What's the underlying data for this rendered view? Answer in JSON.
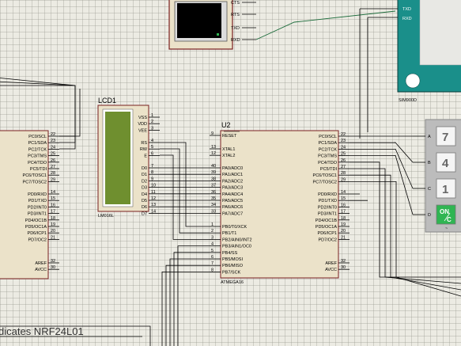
{
  "terminal": {
    "pins": [
      "CTS",
      "RTS",
      "TXD",
      "RXD"
    ]
  },
  "gsm": {
    "name": "SIM900D",
    "pins": [
      "TXD",
      "RXD"
    ]
  },
  "lcd": {
    "ref": "LCD1",
    "model": "LM016L",
    "pins_top": [
      {
        "label": "VSS",
        "num": "1"
      },
      {
        "label": "VDD",
        "num": "2"
      },
      {
        "label": "VEE",
        "num": "3"
      }
    ],
    "pins_ctrl": [
      {
        "label": "RS",
        "num": "4"
      },
      {
        "label": "RW",
        "num": "5"
      },
      {
        "label": "E",
        "num": "6"
      }
    ],
    "pins_data": [
      {
        "label": "D0",
        "num": "7"
      },
      {
        "label": "D1",
        "num": "8"
      },
      {
        "label": "D2",
        "num": "9"
      },
      {
        "label": "D3",
        "num": "10"
      },
      {
        "label": "D4",
        "num": "11"
      },
      {
        "label": "D5",
        "num": "12"
      },
      {
        "label": "D6",
        "num": "13"
      },
      {
        "label": "D7",
        "num": "14"
      }
    ]
  },
  "mcu_left": {
    "portc": [
      {
        "label": "PC0/SCL",
        "num": "22"
      },
      {
        "label": "PC1/SDA",
        "num": "23"
      },
      {
        "label": "PC2/TCK",
        "num": "24"
      },
      {
        "label": "PC3/TMS",
        "num": "25"
      },
      {
        "label": "PC4/TDO",
        "num": "26"
      },
      {
        "label": "PC5/TDI",
        "num": "27"
      },
      {
        "label": "PC6/TOSC1",
        "num": "28"
      },
      {
        "label": "PC7/TOSC2",
        "num": "29"
      }
    ],
    "portd": [
      {
        "label": "PD0/RXD",
        "num": "14"
      },
      {
        "label": "PD1/TXD",
        "num": "15"
      },
      {
        "label": "PD2/INT0",
        "num": "16"
      },
      {
        "label": "PD3/INT1",
        "num": "17"
      },
      {
        "label": "PD4/OC1B",
        "num": "18"
      },
      {
        "label": "PD5/OC1A",
        "num": "19"
      },
      {
        "label": "PD6/ICP1",
        "num": "20"
      },
      {
        "label": "PD7/OC2",
        "num": "21"
      }
    ],
    "power": [
      {
        "label": "AREF",
        "num": "32"
      },
      {
        "label": "AVCC",
        "num": "30"
      }
    ]
  },
  "mcu": {
    "ref": "U2",
    "model": "ATMEGA16",
    "reset": {
      "label": "RESET",
      "num": "9"
    },
    "xtal": [
      {
        "label": "XTAL1",
        "num": "13"
      },
      {
        "label": "XTAL2",
        "num": "12"
      }
    ],
    "porta": [
      {
        "label": "PA0/ADC0",
        "num": "40"
      },
      {
        "label": "PA1/ADC1",
        "num": "39"
      },
      {
        "label": "PA2/ADC2",
        "num": "38"
      },
      {
        "label": "PA3/ADC3",
        "num": "37"
      },
      {
        "label": "PA4/ADC4",
        "num": "36"
      },
      {
        "label": "PA5/ADC5",
        "num": "35"
      },
      {
        "label": "PA6/ADC6",
        "num": "34"
      },
      {
        "label": "PA7/ADC7",
        "num": "33"
      }
    ],
    "portb": [
      {
        "label": "PB0/T0/XCK",
        "num": "1"
      },
      {
        "label": "PB1/T1",
        "num": "2"
      },
      {
        "label": "PB2/AIN0/INT2",
        "num": "3"
      },
      {
        "label": "PB3/AIN1/OC0",
        "num": "4"
      },
      {
        "label": "PB4/SS",
        "num": "5"
      },
      {
        "label": "PB5/MOSI",
        "num": "6"
      },
      {
        "label": "PB6/MISO",
        "num": "7"
      },
      {
        "label": "PB7/SCK",
        "num": "8"
      }
    ],
    "portc": [
      {
        "label": "PC0/SCL",
        "num": "22"
      },
      {
        "label": "PC1/SDA",
        "num": "23"
      },
      {
        "label": "PC2/TCK",
        "num": "24"
      },
      {
        "label": "PC3/TMS",
        "num": "25"
      },
      {
        "label": "PC4/TDO",
        "num": "26"
      },
      {
        "label": "PC5/TDI",
        "num": "27"
      },
      {
        "label": "PC6/TOSC1",
        "num": "28"
      },
      {
        "label": "PC7/TOSC2",
        "num": "29"
      }
    ],
    "portd": [
      {
        "label": "PD0/RXD",
        "num": "14"
      },
      {
        "label": "PD1/TXD",
        "num": "15"
      },
      {
        "label": "PD2/INT0",
        "num": "16"
      },
      {
        "label": "PD3/INT1",
        "num": "17"
      },
      {
        "label": "PD4/OC1B",
        "num": "18"
      },
      {
        "label": "PD5/OC1A",
        "num": "19"
      },
      {
        "label": "PD6/ICP1",
        "num": "20"
      },
      {
        "label": "PD7/OC2",
        "num": "21"
      }
    ],
    "power": [
      {
        "label": "AREF",
        "num": "32"
      },
      {
        "label": "AVCC",
        "num": "30"
      }
    ]
  },
  "keypad": {
    "rows": [
      "A",
      "B",
      "C",
      "D"
    ],
    "keys": [
      "7",
      "4",
      "1",
      "ON/C"
    ],
    "on_top": "ON",
    "on_bottom": "C"
  },
  "note": "dicates NRF24L01",
  "colors": {
    "gsm_teal": "#1a8f8a",
    "lcd_screen": "#6f8f2f",
    "chip_fill": "#ebe2c9",
    "key_on": "#2fb552",
    "wire": "#000000"
  }
}
